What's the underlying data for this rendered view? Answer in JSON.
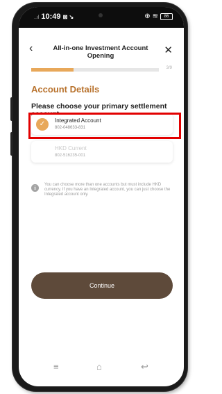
{
  "status_bar": {
    "signal": "..ıl",
    "time": "10:49",
    "icons": "⊠ ↘",
    "battery": "86"
  },
  "header": {
    "title": "All-in-one Investment Account\nOpening",
    "back_icon": "chevron-left-icon",
    "close_icon": "close-icon"
  },
  "progress": {
    "text": "3/9",
    "fraction": 0.33
  },
  "section_title": "Account Details",
  "question": "Please choose your primary settlement account",
  "accounts": [
    {
      "name": "Integrated Account",
      "number": "802-048633-831",
      "selected": true
    },
    {
      "name": "HKD Current",
      "number": "802-516235-001",
      "selected": false
    }
  ],
  "info_note": "You can choose more than one accounts but must include HKD currency. If you have an Integrated account, you can just choose the Integrated account only.",
  "continue_label": "Continue",
  "nav": {
    "menu": "≡",
    "home": "⌂",
    "back": "↩"
  },
  "colors": {
    "accent": "#b8722d",
    "progress": "#e8a85a",
    "button": "#5e4a3a",
    "highlight": "#e20000"
  }
}
